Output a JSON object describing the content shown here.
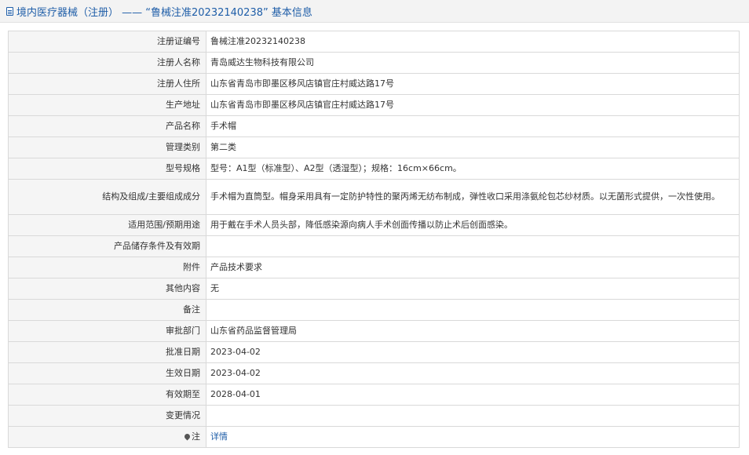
{
  "header": {
    "title": "境内医疗器械（注册） ——  “鲁械注准20232140238” 基本信息",
    "icon": "document-icon"
  },
  "rows": [
    {
      "label": "注册证编号",
      "value": "鲁械注准20232140238"
    },
    {
      "label": "注册人名称",
      "value": "青岛威达生物科技有限公司"
    },
    {
      "label": "注册人住所",
      "value": "山东省青岛市即墨区移风店镇官庄村威达路17号"
    },
    {
      "label": "生产地址",
      "value": "山东省青岛市即墨区移风店镇官庄村威达路17号"
    },
    {
      "label": "产品名称",
      "value": "手术帽"
    },
    {
      "label": "管理类别",
      "value": "第二类"
    },
    {
      "label": "型号规格",
      "value": "型号：A1型（标准型）、A2型（透湿型）；规格：16cm×66cm。"
    },
    {
      "label": "结构及组成/主要组成成分",
      "value": "手术帽为直筒型。帽身采用具有一定防护特性的聚丙烯无纺布制成，弹性收口采用涤氨纶包芯纱材质。以无菌形式提供，一次性使用。"
    },
    {
      "label": "适用范围/预期用途",
      "value": "用于戴在手术人员头部，降低感染源向病人手术创面传播以防止术后创面感染。"
    },
    {
      "label": "产品储存条件及有效期",
      "value": ""
    },
    {
      "label": "附件",
      "value": "产品技术要求"
    },
    {
      "label": "其他内容",
      "value": "无"
    },
    {
      "label": "备注",
      "value": ""
    },
    {
      "label": "审批部门",
      "value": "山东省药品监督管理局"
    },
    {
      "label": "批准日期",
      "value": "2023-04-02"
    },
    {
      "label": "生效日期",
      "value": "2023-04-02"
    },
    {
      "label": "有效期至",
      "value": "2028-04-01"
    },
    {
      "label": "变更情况",
      "value": ""
    }
  ],
  "note_row": {
    "label": "注",
    "icon": "pin-icon",
    "link_text": "详情"
  },
  "colors": {
    "header_text": "#1f5ea8",
    "label_bg": "#f5f5f5",
    "border": "#d9d9d9",
    "link": "#1f5ea8"
  }
}
